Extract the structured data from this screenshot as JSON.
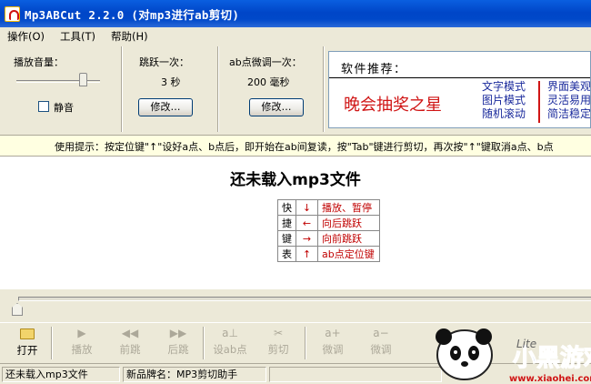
{
  "window": {
    "title": "Mp3ABCut 2.2.0 (对mp3进行ab剪切)"
  },
  "menu": [
    "操作(O)",
    "工具(T)",
    "帮助(H)"
  ],
  "volume": {
    "label": "播放音量：",
    "mute_label": "静音",
    "level": 0.82,
    "muted": false
  },
  "jump": {
    "label": "跳跃一次：",
    "value": "3 秒",
    "modify": "修改…"
  },
  "fine": {
    "label": "ab点微调一次：",
    "value": "200 毫秒",
    "modify": "修改…"
  },
  "recommend": {
    "title": "软件推荐：",
    "main": "晚会抽奖之星",
    "col1": [
      "文字模式",
      "图片模式",
      "随机滚动"
    ],
    "col2": [
      "界面美观",
      "灵活易用",
      "简洁稳定"
    ]
  },
  "tip": "使用提示：按定位键\"↑\"设好a点、b点后，即开始在ab间复读，按\"Tab\"键进行剪切，再次按\"↑\"键取消a点、b点",
  "main_status": "还未载入mp3文件",
  "shortcuts": {
    "chars": [
      "快",
      "捷",
      "键",
      "表"
    ],
    "rows": [
      {
        "arrow": "↓",
        "desc": "播放、暂停"
      },
      {
        "arrow": "←",
        "desc": "向后跳跃"
      },
      {
        "arrow": "→",
        "desc": "向前跳跃"
      },
      {
        "arrow": "↑",
        "desc": "ab点定位键"
      }
    ]
  },
  "toolbar": {
    "open": "打开",
    "play": "播放",
    "prev": "前跳",
    "next": "后跳",
    "set_ab": "设ab点",
    "cut": "剪切",
    "fine1": "微调",
    "fine2": "微调"
  },
  "status": {
    "left": "还未载入mp3文件",
    "right": "新品牌名：MP3剪切助手"
  },
  "watermark": {
    "brand": "小黑游戏",
    "url": "www.xiaohei.com",
    "partial": "Lite"
  },
  "colors": {
    "accent_red": "#d01515",
    "link_blue": "#1a2a9c",
    "tip_bg": "#ffffe1"
  }
}
